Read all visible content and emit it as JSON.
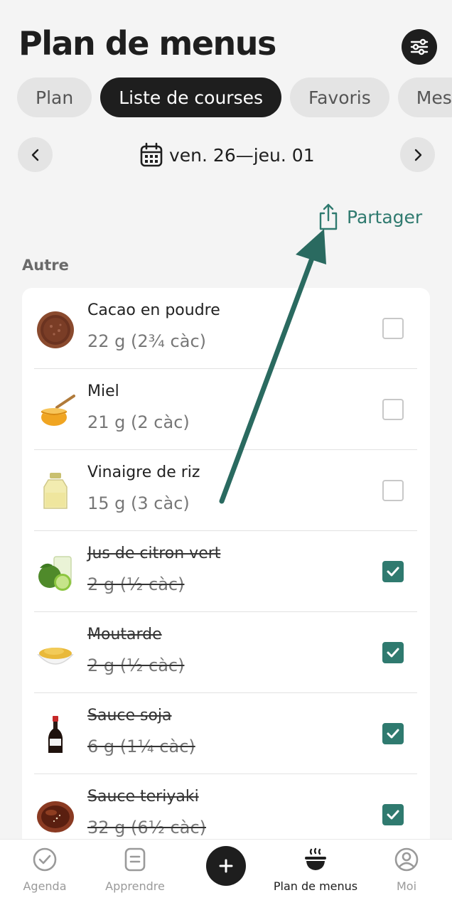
{
  "header": {
    "title": "Plan de menus"
  },
  "tabs": [
    {
      "label": "Plan",
      "active": false
    },
    {
      "label": "Liste de courses",
      "active": true
    },
    {
      "label": "Favoris",
      "active": false
    },
    {
      "label": "Mes",
      "active": false
    }
  ],
  "date_nav": {
    "range": "ven. 26—jeu. 01"
  },
  "share": {
    "label": "Partager"
  },
  "section": {
    "label": "Autre"
  },
  "items": [
    {
      "name": "Cacao en poudre",
      "qty": "22 g (2¾ càc)",
      "checked": false,
      "icon": "cocoa-powder-image"
    },
    {
      "name": "Miel",
      "qty": "21 g (2 càc)",
      "checked": false,
      "icon": "honey-image"
    },
    {
      "name": "Vinaigre de riz",
      "qty": "15 g (3 càc)",
      "checked": false,
      "icon": "rice-vinegar-image"
    },
    {
      "name": "Jus de citron vert",
      "qty": "2 g (½ càc)",
      "checked": true,
      "icon": "lime-juice-image"
    },
    {
      "name": "Moutarde",
      "qty": "2 g (½ càc)",
      "checked": true,
      "icon": "mustard-image"
    },
    {
      "name": "Sauce soja",
      "qty": "6 g (1¼ càc)",
      "checked": true,
      "icon": "soy-sauce-image"
    },
    {
      "name": "Sauce teriyaki",
      "qty": "32 g (6½ càc)",
      "checked": true,
      "icon": "teriyaki-sauce-image"
    }
  ],
  "bottom_nav": [
    {
      "label": "Agenda",
      "active": false,
      "icon": "check-circle-icon"
    },
    {
      "label": "Apprendre",
      "active": false,
      "icon": "book-icon"
    },
    {
      "label": "Plan de menus",
      "active": true,
      "icon": "bowl-icon"
    },
    {
      "label": "Moi",
      "active": false,
      "icon": "profile-icon"
    }
  ],
  "colors": {
    "accent": "#2f7a6f",
    "dark": "#1e1e1e",
    "background": "#f4f4f4"
  }
}
